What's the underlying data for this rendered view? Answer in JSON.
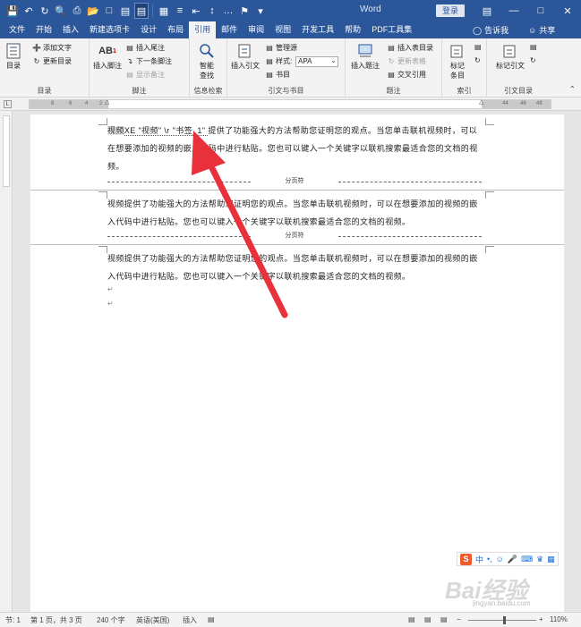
{
  "app": {
    "title": "Word",
    "signin": "登录",
    "window_controls": [
      "minimize-icon",
      "restore-icon",
      "close-icon"
    ]
  },
  "quick_access": [
    "save-icon",
    "undo-icon",
    "redo-icon",
    "print-preview-icon",
    "print-icon",
    "open-icon",
    "new-icon",
    "doc-icon",
    "view-icon",
    "table-icon",
    "bullets-icon",
    "align-icon",
    "spacing-icon",
    "special-icon",
    "bookmark-icon",
    "more-icon"
  ],
  "tabs": [
    "文件",
    "开始",
    "插入",
    "新建选项卡",
    "设计",
    "布局",
    "引用",
    "邮件",
    "审阅",
    "视图",
    "开发工具",
    "帮助",
    "PDF工具集"
  ],
  "active_tab": "引用",
  "tell_me": "告诉我",
  "share": "共享",
  "ribbon": {
    "toc": {
      "big": "目录",
      "add_text": "添加文字",
      "update": "更新目录",
      "label": "目录"
    },
    "footnotes": {
      "insert_footnote": "插入脚注",
      "insert_endnote": "插入尾注",
      "next_footnote": "下一条脚注",
      "show_notes": "显示备注",
      "label": "脚注"
    },
    "research": {
      "smart_lookup": "智能",
      "smart_lookup2": "查找",
      "label": "信息检索"
    },
    "citations": {
      "insert_citation": "插入引文",
      "manage_sources": "管理源",
      "style_label": "样式:",
      "style_value": "APA",
      "bibliography": "书目",
      "label": "引文与书目"
    },
    "captions": {
      "insert_caption": "插入题注",
      "insert_table_of_figures": "插入表目录",
      "update_table": "更新表格",
      "cross_reference": "交叉引用",
      "label": "题注"
    },
    "index": {
      "mark_entry": "标记",
      "mark_entry2": "条目",
      "label": "索引"
    },
    "authorities": {
      "mark_citation": "标记引文",
      "label": "引文目录"
    }
  },
  "ruler": {
    "left_ticks": [
      "8",
      "6",
      "4",
      "2"
    ],
    "right_ticks": [
      "44",
      "46",
      "48"
    ]
  },
  "document": {
    "field_prefix": "视频",
    "field_code": "XE \"视频\" \\r \"书签_1\" ",
    "para1_rest": "提供了功能强大的方法帮助您证明您的观点。当您单击联机视频时，可以在想要添加的视频的嵌入代码中进行粘贴。您也可以键入一个关键字以联机搜索最适合您的文档的视频。",
    "page_break": "分页符",
    "para2": "视频提供了功能强大的方法帮助您证明您的观点。当您单击联机视频时，可以在想要添加的视频的嵌入代码中进行粘贴。您也可以键入一个关键字以联机搜索最适合您的文档的视频。",
    "para3": "视频提供了功能强大的方法帮助您证明您的观点。当您单击联机视频时，可以在想要添加的视频的嵌入代码中进行粘贴。您也可以键入一个关键字以联机搜索最适合您的文档的视频。",
    "pilcrow": "↵"
  },
  "ime": {
    "logo": "S",
    "mode": "中"
  },
  "watermark": "Bai经验",
  "watermark_url": "jingyan.baidu.com",
  "status": {
    "section": "节: 1",
    "page": "第 1 页，共 3 页",
    "words": "240 个字",
    "language": "英语(美国)",
    "mode": "插入",
    "zoom": "110%"
  },
  "colors": {
    "accent": "#2b579a",
    "arrow": "#e8313a"
  }
}
